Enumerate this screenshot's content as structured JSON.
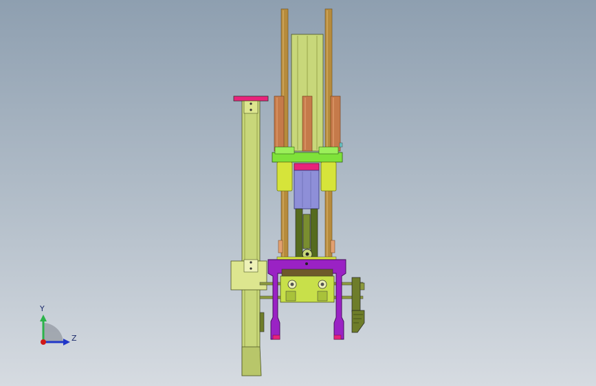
{
  "viewport": {
    "background_top": "#8e9fb0",
    "background_bottom": "#d6dbe1"
  },
  "triad": {
    "y_label": "Y",
    "z_label": "Z",
    "y_color": "#2bb34a",
    "z_color": "#2036c8",
    "origin_color": "#d01818"
  },
  "model": {
    "colors": {
      "rod": "#b68b3c",
      "sleeve": "#c57a4a",
      "frame": "#c8d77a",
      "frame_dark": "#8c9a3e",
      "block_green": "#7fe23a",
      "bushing": "#d6e43a",
      "accent_pink": "#e8237a",
      "cylinder_blue": "#8e8fd8",
      "arm_dark": "#556b1e",
      "gripper_purple": "#9a22c4",
      "bracket_olive": "#6e7d2a"
    }
  }
}
